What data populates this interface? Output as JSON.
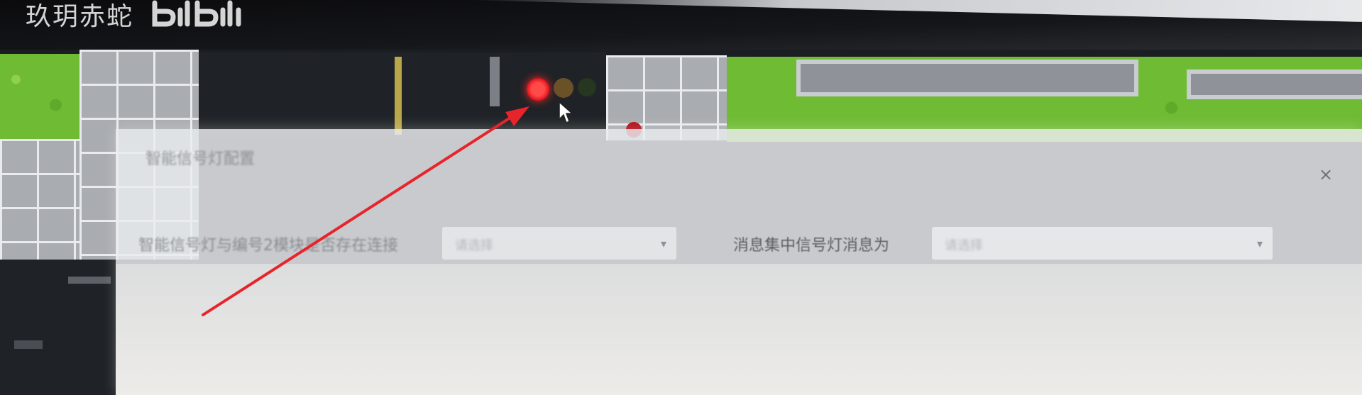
{
  "watermark": {
    "text": "玖玥赤蛇",
    "logo": "bilibili"
  },
  "scene": {
    "traffic_light": {
      "icon_red": "traffic-light-red-icon",
      "icon_yellow": "traffic-light-yellow-icon",
      "icon_green": "traffic-light-green-icon",
      "active": "red"
    },
    "accent_red": "#e0111a",
    "annotation_arrow_color": "#e8242b"
  },
  "dialog": {
    "title": "智能信号灯配置",
    "close_symbol": "×",
    "fields": [
      {
        "label": "智能信号灯与编号2模块是否存在连接",
        "value": "请选择",
        "chevron": "▾"
      },
      {
        "label": "消息集中信号灯消息为",
        "value": "请选择",
        "chevron": "▾"
      }
    ]
  }
}
